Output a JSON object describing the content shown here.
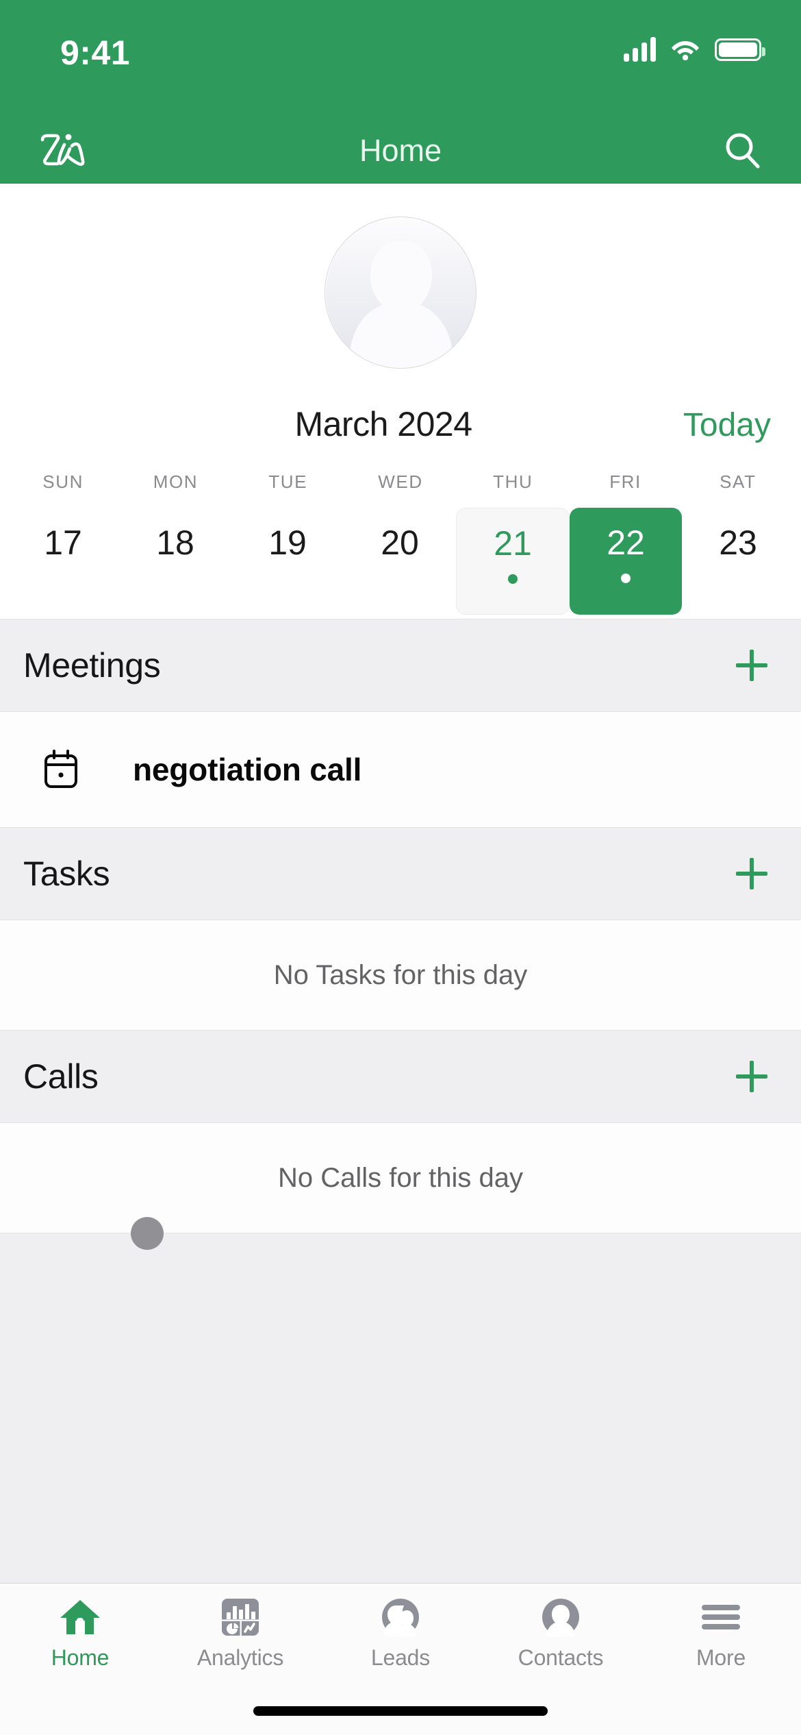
{
  "status_bar": {
    "time": "9:41",
    "signal_icon": "cellular-signal-icon",
    "wifi_icon": "wifi-icon",
    "battery_icon": "battery-full-icon"
  },
  "nav_bar": {
    "logo_icon": "zia-logo-icon",
    "title": "Home",
    "search_icon": "search-icon"
  },
  "profile": {
    "avatar_icon": "default-user-avatar"
  },
  "calendar": {
    "month_label": "March 2024",
    "today_label": "Today",
    "weekdays": [
      "SUN",
      "MON",
      "TUE",
      "WED",
      "THU",
      "FRI",
      "SAT"
    ],
    "days": [
      {
        "number": "17",
        "state": "normal",
        "has_event": false
      },
      {
        "number": "18",
        "state": "normal",
        "has_event": false
      },
      {
        "number": "19",
        "state": "normal",
        "has_event": false
      },
      {
        "number": "20",
        "state": "normal",
        "has_event": false
      },
      {
        "number": "21",
        "state": "today",
        "has_event": true
      },
      {
        "number": "22",
        "state": "selected",
        "has_event": true
      },
      {
        "number": "23",
        "state": "normal",
        "has_event": false
      }
    ]
  },
  "sections": {
    "meetings": {
      "title": "Meetings",
      "add_label": "+",
      "items": [
        {
          "icon": "calendar-event-icon",
          "title": "negotiation call"
        }
      ]
    },
    "tasks": {
      "title": "Tasks",
      "add_label": "+",
      "empty_text": "No Tasks for this day"
    },
    "calls": {
      "title": "Calls",
      "add_label": "+",
      "empty_text": "No Calls for this day"
    }
  },
  "touch_indicator": {
    "name": "touch-point-indicator"
  },
  "tab_bar": {
    "tabs": [
      {
        "label": "Home",
        "icon": "home-icon",
        "active": true
      },
      {
        "label": "Analytics",
        "icon": "analytics-icon",
        "active": false
      },
      {
        "label": "Leads",
        "icon": "leads-icon",
        "active": false
      },
      {
        "label": "Contacts",
        "icon": "contacts-icon",
        "active": false
      },
      {
        "label": "More",
        "icon": "hamburger-menu-icon",
        "active": false
      }
    ]
  },
  "colors": {
    "brand_green": "#2E9A5C",
    "section_gray": "#EFEEF0",
    "muted_text": "#636366",
    "icon_gray": "#8E9099"
  }
}
